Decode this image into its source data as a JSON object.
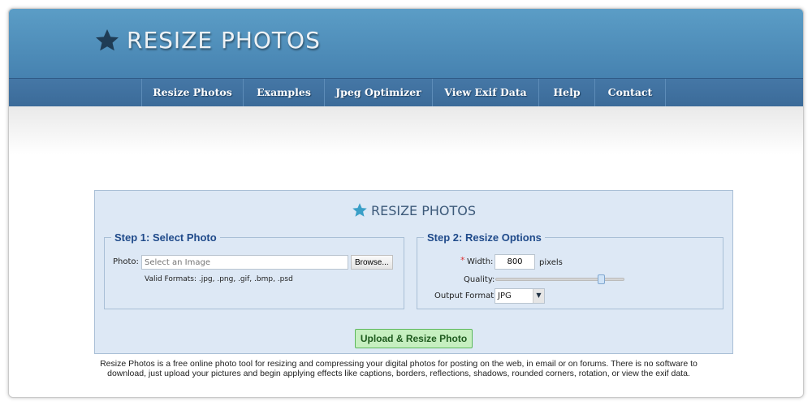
{
  "header": {
    "logo_text": "RESIZE PHOTOS"
  },
  "nav": [
    "Resize Photos",
    "Examples",
    "Jpeg Optimizer",
    "View Exif Data",
    "Help",
    "Contact"
  ],
  "panel": {
    "title": "RESIZE PHOTOS",
    "step1": {
      "legend": "Step 1: Select Photo",
      "photo_label": "Photo:",
      "photo_placeholder": "Select an Image",
      "browse_label": "Browse...",
      "formats": "Valid Formats: .jpg, .png, .gif, .bmp, .psd"
    },
    "step2": {
      "legend": "Step 2: Resize Options",
      "required_mark": "*",
      "width_label": "Width:",
      "width_value": "800",
      "width_unit": "pixels",
      "quality_label": "Quality:",
      "quality_fraction": 0.82,
      "format_label": "Output Format:",
      "format_value": "JPG"
    },
    "upload_label": "Upload & Resize Photo"
  },
  "description": "Resize Photos is a free online photo tool for resizing and compressing your digital photos for posting on the web, in email or on forums. There is no software to download, just upload your pictures and begin applying effects like captions, borders, reflections, shadows, rounded corners, rotation, or view the exif data."
}
